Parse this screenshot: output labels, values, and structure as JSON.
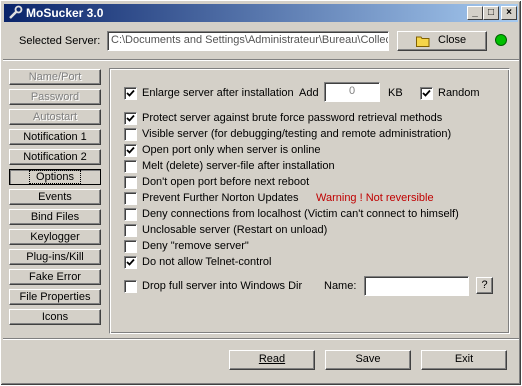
{
  "window": {
    "title": "MoSucker 3.0",
    "minimize": "_",
    "maximize": "□",
    "close": "×"
  },
  "server": {
    "label": "Selected Server:",
    "path": "C:\\Documents and Settings\\Administrateur\\Bureau\\Collect",
    "close_button": "Close",
    "status_color": "#00c000"
  },
  "nav": [
    {
      "label": "Name/Port",
      "state": "disabled"
    },
    {
      "label": "Password",
      "state": "disabled"
    },
    {
      "label": "Autostart",
      "state": "disabled"
    },
    {
      "label": "Notification 1",
      "state": "normal"
    },
    {
      "label": "Notification 2",
      "state": "normal"
    },
    {
      "label": "Options",
      "state": "active"
    },
    {
      "label": "Events",
      "state": "normal"
    },
    {
      "label": "Bind Files",
      "state": "normal"
    },
    {
      "label": "Keylogger",
      "state": "normal"
    },
    {
      "label": "Plug-ins/Kill",
      "state": "normal"
    },
    {
      "label": "Fake Error",
      "state": "normal"
    },
    {
      "label": "File Properties",
      "state": "normal"
    },
    {
      "label": "Icons",
      "state": "normal"
    }
  ],
  "options": {
    "enlarge": {
      "label": "Enlarge server after installation",
      "checked": true
    },
    "add_label": "Add",
    "add_value": "0",
    "kb_label": "KB",
    "random": {
      "label": "Random",
      "checked": true
    },
    "items": [
      {
        "label": "Protect server against brute force password retrieval methods",
        "checked": true
      },
      {
        "label": "Visible server  (for debugging/testing and remote administration)",
        "checked": false
      },
      {
        "label": "Open port only when server is online",
        "checked": true
      },
      {
        "label": "Melt (delete) server-file after installation",
        "checked": false
      },
      {
        "label": "Don't open port before next reboot",
        "checked": false
      },
      {
        "label": "Prevent Further Norton Updates",
        "checked": false
      },
      {
        "label": "Deny connections from localhost (Victim can't connect to himself)",
        "checked": false
      },
      {
        "label": "Unclosable server (Restart on unload)",
        "checked": false
      },
      {
        "label": "Deny \"remove server\"",
        "checked": false
      },
      {
        "label": "Do not allow Telnet-control",
        "checked": true
      }
    ],
    "warning": "Warning ! Not reversible",
    "warning_color": "#c00000",
    "drop": {
      "label": "Drop full server into Windows Dir",
      "checked": false
    },
    "name_label": "Name:",
    "name_value": "",
    "help_button": "?"
  },
  "footer": {
    "read": "Read",
    "save": "Save",
    "exit": "Exit"
  }
}
